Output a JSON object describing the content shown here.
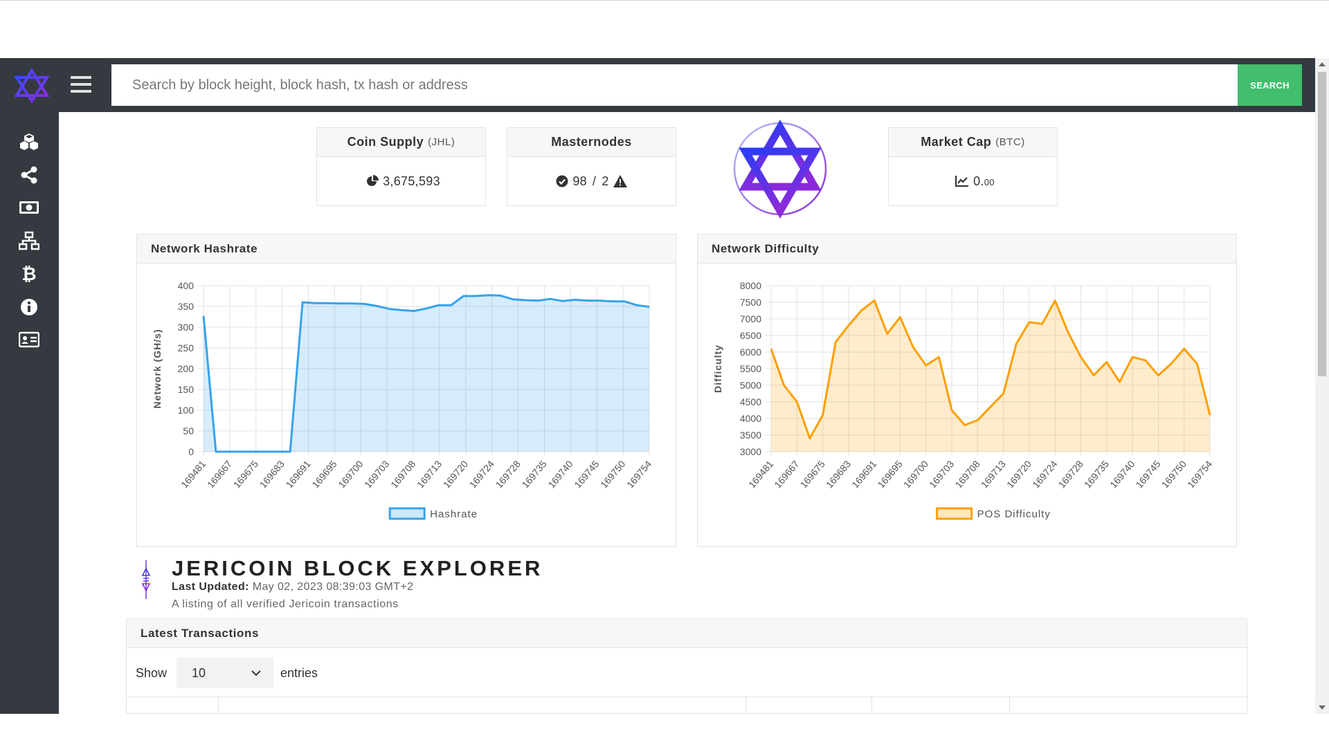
{
  "search": {
    "placeholder": "Search by block height, block hash, tx hash or address",
    "button_label": "SEARCH"
  },
  "sidebar": {
    "items": [
      {
        "icon": "cubes-icon"
      },
      {
        "icon": "share-icon"
      },
      {
        "icon": "money-icon"
      },
      {
        "icon": "network-icon"
      },
      {
        "icon": "bitcoin-icon"
      },
      {
        "icon": "info-icon"
      },
      {
        "icon": "id-card-icon"
      }
    ]
  },
  "stats": {
    "coin_supply": {
      "label": "Coin Supply",
      "unit": "(JHL)",
      "value": "3,675,593"
    },
    "masternodes": {
      "label": "Masternodes",
      "online": "98",
      "separator": "/",
      "offline": "2"
    },
    "market_cap": {
      "label": "Market Cap",
      "unit": "(BTC)",
      "value": "0.",
      "value_small": "00"
    }
  },
  "colors": {
    "sidebar": "#343a40",
    "search_button": "#43bd6e",
    "hashrate_line": "#36a2eb",
    "difficulty_line": "#ff9f00"
  },
  "chart_data": [
    {
      "type": "area",
      "title": "Network Hashrate",
      "ylabel": "Network (GH/s)",
      "ylim": [
        0,
        400
      ],
      "yticks": [
        0,
        50,
        100,
        150,
        200,
        250,
        300,
        350,
        400
      ],
      "x_tick_labels": [
        "169481",
        "169667",
        "169675",
        "169683",
        "169691",
        "169695",
        "169700",
        "169703",
        "169708",
        "169713",
        "169720",
        "169724",
        "169728",
        "169735",
        "169740",
        "169745",
        "169750",
        "169754"
      ],
      "series": [
        {
          "name": "Hashrate",
          "values": [
            327,
            0,
            0,
            0,
            0,
            0,
            0,
            0,
            360,
            358,
            358,
            357,
            357,
            356,
            351,
            344,
            341,
            339,
            345,
            353,
            353,
            375,
            375,
            377,
            376,
            367,
            365,
            364,
            368,
            363,
            366,
            364,
            364,
            362,
            362,
            353,
            349
          ]
        }
      ],
      "grid": true,
      "legend": "bottom"
    },
    {
      "type": "area",
      "title": "Network Difficulty",
      "ylabel": "Difficulty",
      "ylim": [
        3000,
        8000
      ],
      "yticks": [
        3000,
        3500,
        4000,
        4500,
        5000,
        5500,
        6000,
        6500,
        7000,
        7500,
        8000
      ],
      "x_tick_labels": [
        "169481",
        "169667",
        "169675",
        "169683",
        "169691",
        "169695",
        "169700",
        "169703",
        "169708",
        "169713",
        "169720",
        "169724",
        "169728",
        "169735",
        "169740",
        "169745",
        "169750",
        "169754"
      ],
      "series": [
        {
          "name": "POS Difficulty",
          "values": [
            6100,
            5000,
            4500,
            3400,
            4100,
            6300,
            6800,
            7250,
            7550,
            6550,
            7050,
            6150,
            5600,
            5850,
            4250,
            3800,
            3950,
            4350,
            4750,
            6250,
            6900,
            6850,
            7550,
            6600,
            5850,
            5300,
            5700,
            5100,
            5850,
            5750,
            5300,
            5650,
            6100,
            5650,
            4100
          ]
        }
      ],
      "grid": true,
      "legend": "bottom"
    }
  ],
  "explorer": {
    "title": "JERICOIN BLOCK EXPLORER",
    "last_updated_label": "Last Updated:",
    "last_updated_value": "May 02, 2023 08:39:03 GMT+2",
    "subtitle": "A listing of all verified Jericoin transactions"
  },
  "transactions": {
    "title": "Latest Transactions",
    "show_label": "Show",
    "entries_value": "10",
    "entries_label": "entries"
  }
}
